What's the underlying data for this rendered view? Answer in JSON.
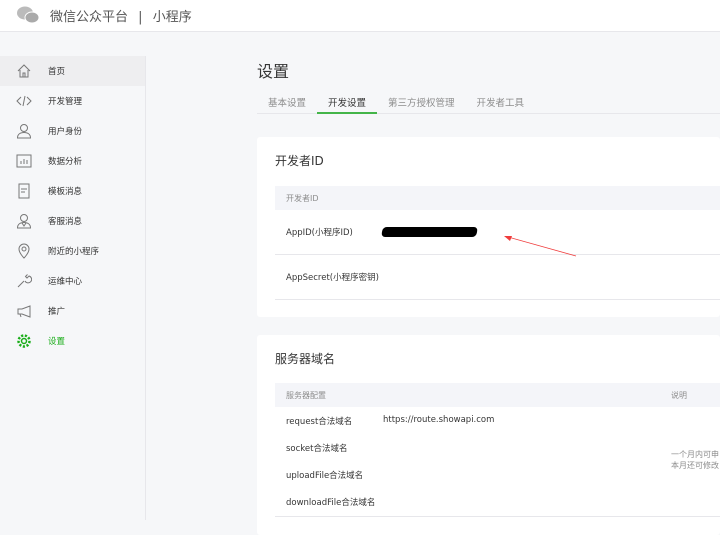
{
  "header": {
    "brand": "微信公众平台",
    "separator": "|",
    "product": "小程序"
  },
  "sidebar": {
    "items": [
      {
        "label": "首页",
        "icon": "home-icon"
      },
      {
        "label": "开发管理",
        "icon": "code-icon"
      },
      {
        "label": "用户身份",
        "icon": "user-icon"
      },
      {
        "label": "数据分析",
        "icon": "chart-icon"
      },
      {
        "label": "模板消息",
        "icon": "document-icon"
      },
      {
        "label": "客服消息",
        "icon": "customer-service-icon"
      },
      {
        "label": "附近的小程序",
        "icon": "location-icon"
      },
      {
        "label": "运维中心",
        "icon": "wrench-icon"
      },
      {
        "label": "推广",
        "icon": "megaphone-icon"
      },
      {
        "label": "设置",
        "icon": "gear-icon"
      }
    ]
  },
  "page": {
    "title": "设置",
    "tabs": [
      "基本设置",
      "开发设置",
      "第三方授权管理",
      "开发者工具"
    ]
  },
  "developer_id": {
    "title": "开发者ID",
    "header": "开发者ID",
    "rows": [
      "AppID(小程序ID)",
      "AppSecret(小程序密钥)"
    ]
  },
  "server": {
    "title": "服务器域名",
    "header_config": "服务器配置",
    "header_desc": "说明",
    "rows": [
      {
        "label": "request合法域名",
        "value": "https://route.showapi.com"
      },
      {
        "label": "socket合法域名"
      },
      {
        "label": "uploadFile合法域名"
      },
      {
        "label": "downloadFile合法域名"
      }
    ],
    "desc_line1": "一个月内可申",
    "desc_line2": "本月还可修改"
  },
  "colors": {
    "accent": "#1aad19",
    "arrow": "#f03c3c"
  }
}
